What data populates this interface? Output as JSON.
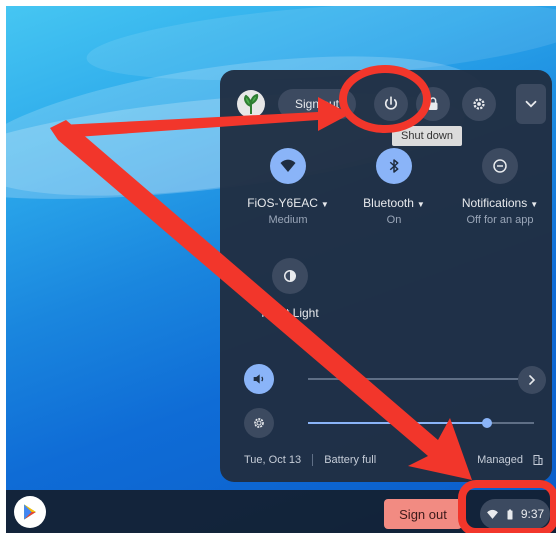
{
  "panel": {
    "sign_out_label": "Sign out",
    "power_tooltip": "Shut down",
    "tiles": [
      {
        "label": "FiOS-Y6EAC",
        "sub": "Medium",
        "icon": "wifi-icon"
      },
      {
        "label": "Bluetooth",
        "sub": "On",
        "icon": "bluetooth-icon"
      },
      {
        "label": "Notifications",
        "sub": "Off for an app",
        "icon": "notifications-icon"
      }
    ],
    "night_light_label": "Night Light",
    "volume_level": 0.0,
    "brightness_level": 0.79,
    "date": "Tue, Oct 13",
    "battery_status": "Battery full",
    "managed_label": "Managed"
  },
  "shelf": {
    "sign_out_label": "Sign out",
    "time": "9:37"
  },
  "colors": {
    "accent": "#8ab4f8",
    "panel_bg": "#202e42",
    "annotation_red": "#f2362b",
    "sign_out_pink": "#f28b82"
  }
}
